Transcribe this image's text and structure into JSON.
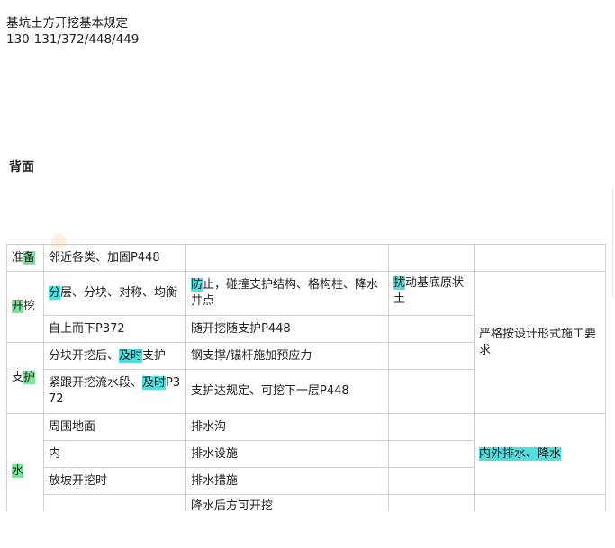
{
  "header": {
    "title": "基坑土方开挖基本规定",
    "pages": "130-131/372/448/449"
  },
  "section": {
    "label": "背面"
  },
  "table": {
    "prep": {
      "label_hl": "备",
      "label_pre": "准",
      "col2": "邻近各类、加固P448"
    },
    "dig": {
      "label_hl": "开",
      "label_post": "挖",
      "r1": {
        "c2_hl": "分",
        "c2_rest": "层、分块、对称、均衡",
        "c3_hl": "防",
        "c3_rest": "止，碰撞支护结构、格构柱、降水井点",
        "c4_hl": "扰",
        "c4_rest": "动基底原状土"
      },
      "r2": {
        "c2": "自上而下P372",
        "c3": "随开挖随支护P448"
      },
      "note": "严格按设计形式施工要求"
    },
    "support": {
      "label_pre": "支",
      "label_hl": "护",
      "r1": {
        "c2_pre": "分块开挖后、",
        "c2_hl": "及时",
        "c2_post": "支护",
        "c3": "钢支撑/锚杆施加预应力"
      },
      "r2": {
        "c2_pre": "紧跟开挖流水段、",
        "c2_hl": "及时",
        "c2_post": "P372",
        "c3": "支护达规定、可挖下一层P448"
      }
    },
    "water": {
      "label_hl": "水",
      "r1": {
        "c2": "周围地面",
        "c3": "排水沟"
      },
      "r2": {
        "c2": "内",
        "c3": "排水设施",
        "c5_hl": "内外排水、降水"
      },
      "r3": {
        "c2": "放坡开挖时",
        "c3": "排水措施"
      },
      "r4": {
        "c3": "降水后方可开挖"
      }
    }
  }
}
